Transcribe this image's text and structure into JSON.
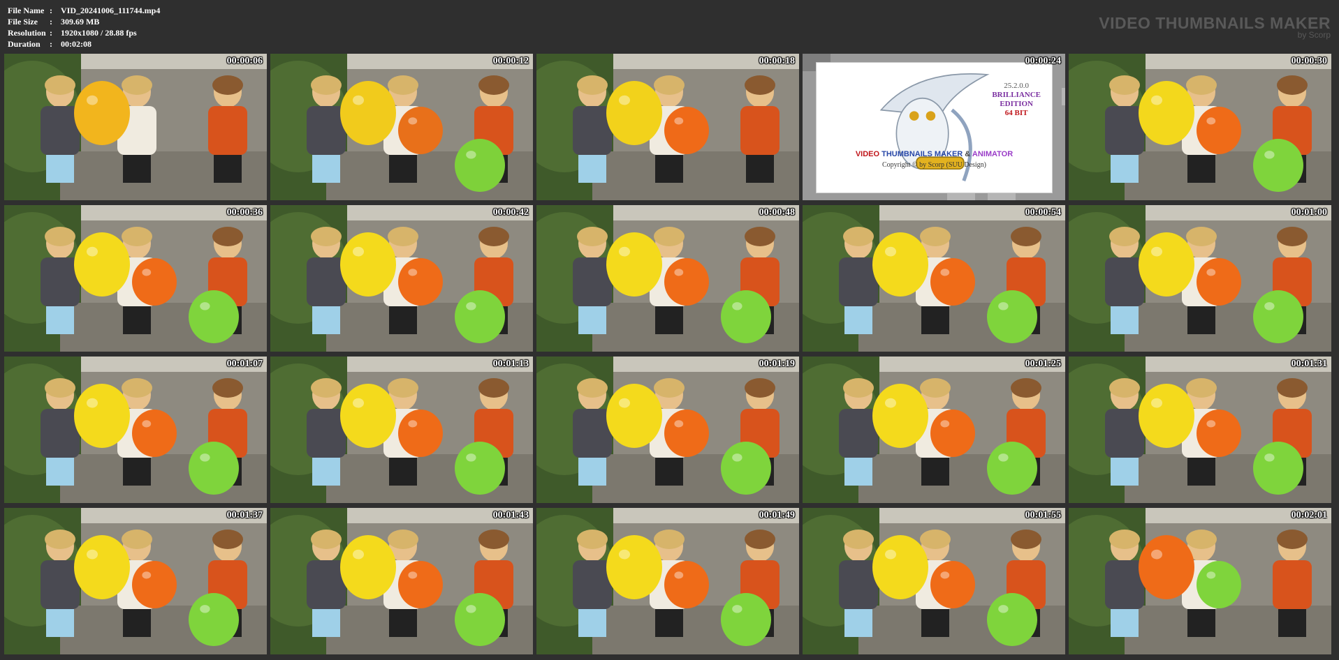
{
  "file_info": {
    "rows": [
      {
        "label": "File Name",
        "sep": ":",
        "value": "VID_20241006_111744.mp4"
      },
      {
        "label": "File Size",
        "sep": ":",
        "value": "309.69 MB"
      },
      {
        "label": "Resolution",
        "sep": ":",
        "value": "1920x1080 / 28.88 fps"
      },
      {
        "label": "Duration",
        "sep": ":",
        "value": "00:02:08"
      }
    ]
  },
  "brand": {
    "title": "VIDEO THUMBNAILS MAKER",
    "subtitle": "by Scorp"
  },
  "splash": {
    "version": "25.2.0.0",
    "edition_line1": "BRILLIANCE",
    "edition_line2": "EDITION",
    "bits": "64 BIT",
    "title_part1": "VIDEO",
    "title_part2": "THUMBNAILS MAKER",
    "title_part3": "&",
    "title_part4": "ANIMATOR",
    "copyright": "Copyright © by Scorp (SUU Design)"
  },
  "thumbnails": [
    {
      "time": "00:00:06",
      "balloons": [
        "#f2b51d"
      ]
    },
    {
      "time": "00:00:12",
      "balloons": [
        "#f1cb1c",
        "#e8701a",
        "#7ed13a"
      ]
    },
    {
      "time": "00:00:18",
      "balloons": [
        "#f2d21b",
        "#ef6a18"
      ]
    },
    {
      "time": "00:00:24",
      "splash": true
    },
    {
      "time": "00:00:30",
      "balloons": [
        "#f3d81c",
        "#ef6b18",
        "#7fd43c"
      ]
    },
    {
      "time": "00:00:36",
      "balloons": [
        "#f4da1c",
        "#ef6b18",
        "#7fd43c"
      ]
    },
    {
      "time": "00:00:42",
      "balloons": [
        "#f4da1c",
        "#ef6b18",
        "#7fd43c"
      ]
    },
    {
      "time": "00:00:48",
      "balloons": [
        "#f4da1c",
        "#ef6b18",
        "#7fd43c"
      ]
    },
    {
      "time": "00:00:54",
      "balloons": [
        "#f4da1c",
        "#ef6b18",
        "#7fd43c"
      ]
    },
    {
      "time": "00:01:00",
      "balloons": [
        "#f4da1c",
        "#ef6b18",
        "#7fd43c"
      ]
    },
    {
      "time": "00:01:07",
      "balloons": [
        "#f4da1c",
        "#ef6b18",
        "#7fd43c"
      ]
    },
    {
      "time": "00:01:13",
      "balloons": [
        "#f4da1c",
        "#ef6b18",
        "#7fd43c"
      ]
    },
    {
      "time": "00:01:19",
      "balloons": [
        "#f4da1c",
        "#ef6b18",
        "#7fd43c"
      ]
    },
    {
      "time": "00:01:25",
      "balloons": [
        "#f4da1c",
        "#ef6b18",
        "#7fd43c"
      ]
    },
    {
      "time": "00:01:31",
      "balloons": [
        "#f4da1c",
        "#ef6b18",
        "#7fd43c"
      ]
    },
    {
      "time": "00:01:37",
      "balloons": [
        "#f4da1c",
        "#ef6b18",
        "#7fd43c"
      ]
    },
    {
      "time": "00:01:43",
      "balloons": [
        "#f4da1c",
        "#ef6b18",
        "#7fd43c"
      ]
    },
    {
      "time": "00:01:49",
      "balloons": [
        "#f4da1c",
        "#ef6b18",
        "#7fd43c"
      ]
    },
    {
      "time": "00:01:55",
      "balloons": [
        "#f4da1c",
        "#ef6b18",
        "#7fd43c"
      ]
    },
    {
      "time": "00:02:01",
      "balloons": [
        "#ef6b18",
        "#7fd43c"
      ]
    }
  ],
  "colors": {
    "background": "#2f2f2f",
    "brand": "#595959",
    "timestamp": "#ffffff"
  }
}
